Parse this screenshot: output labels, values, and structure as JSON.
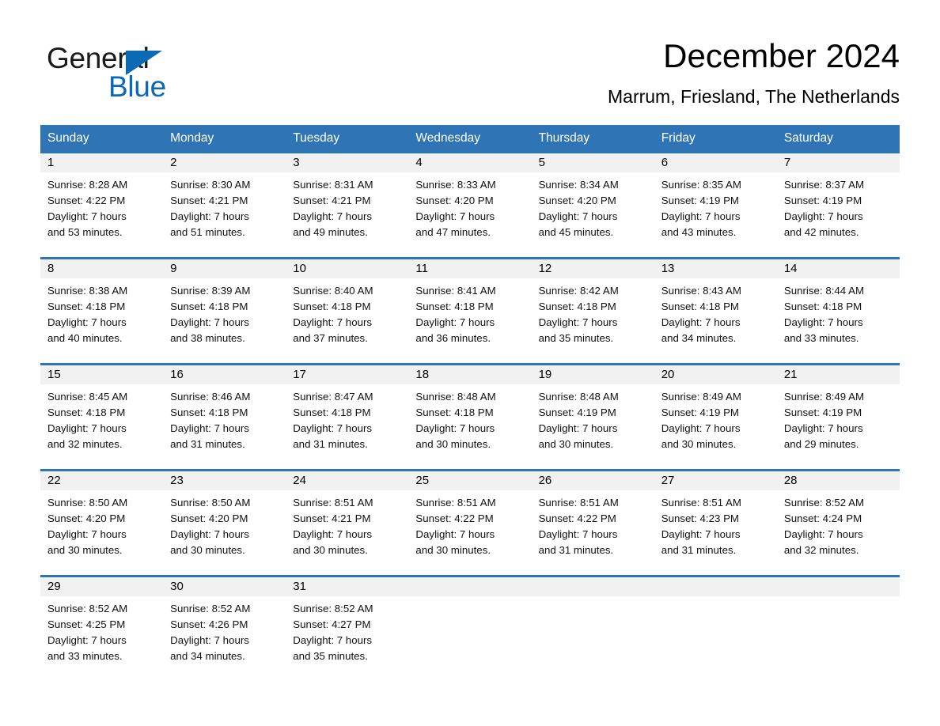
{
  "brand": {
    "name_part1": "General",
    "name_part2": "Blue",
    "accent_color": "#0a6ab5"
  },
  "header": {
    "month_title": "December 2024",
    "location": "Marrum, Friesland, The Netherlands"
  },
  "theme": {
    "header_blue": "#2f75b5",
    "daynum_band": "#f1f1f1",
    "text": "#000000"
  },
  "calendar": {
    "weekday_headers": [
      "Sunday",
      "Monday",
      "Tuesday",
      "Wednesday",
      "Thursday",
      "Friday",
      "Saturday"
    ],
    "weeks": [
      [
        {
          "day": "1",
          "sunrise": "Sunrise: 8:28 AM",
          "sunset": "Sunset: 4:22 PM",
          "daylight_line1": "Daylight: 7 hours",
          "daylight_line2": "and 53 minutes."
        },
        {
          "day": "2",
          "sunrise": "Sunrise: 8:30 AM",
          "sunset": "Sunset: 4:21 PM",
          "daylight_line1": "Daylight: 7 hours",
          "daylight_line2": "and 51 minutes."
        },
        {
          "day": "3",
          "sunrise": "Sunrise: 8:31 AM",
          "sunset": "Sunset: 4:21 PM",
          "daylight_line1": "Daylight: 7 hours",
          "daylight_line2": "and 49 minutes."
        },
        {
          "day": "4",
          "sunrise": "Sunrise: 8:33 AM",
          "sunset": "Sunset: 4:20 PM",
          "daylight_line1": "Daylight: 7 hours",
          "daylight_line2": "and 47 minutes."
        },
        {
          "day": "5",
          "sunrise": "Sunrise: 8:34 AM",
          "sunset": "Sunset: 4:20 PM",
          "daylight_line1": "Daylight: 7 hours",
          "daylight_line2": "and 45 minutes."
        },
        {
          "day": "6",
          "sunrise": "Sunrise: 8:35 AM",
          "sunset": "Sunset: 4:19 PM",
          "daylight_line1": "Daylight: 7 hours",
          "daylight_line2": "and 43 minutes."
        },
        {
          "day": "7",
          "sunrise": "Sunrise: 8:37 AM",
          "sunset": "Sunset: 4:19 PM",
          "daylight_line1": "Daylight: 7 hours",
          "daylight_line2": "and 42 minutes."
        }
      ],
      [
        {
          "day": "8",
          "sunrise": "Sunrise: 8:38 AM",
          "sunset": "Sunset: 4:18 PM",
          "daylight_line1": "Daylight: 7 hours",
          "daylight_line2": "and 40 minutes."
        },
        {
          "day": "9",
          "sunrise": "Sunrise: 8:39 AM",
          "sunset": "Sunset: 4:18 PM",
          "daylight_line1": "Daylight: 7 hours",
          "daylight_line2": "and 38 minutes."
        },
        {
          "day": "10",
          "sunrise": "Sunrise: 8:40 AM",
          "sunset": "Sunset: 4:18 PM",
          "daylight_line1": "Daylight: 7 hours",
          "daylight_line2": "and 37 minutes."
        },
        {
          "day": "11",
          "sunrise": "Sunrise: 8:41 AM",
          "sunset": "Sunset: 4:18 PM",
          "daylight_line1": "Daylight: 7 hours",
          "daylight_line2": "and 36 minutes."
        },
        {
          "day": "12",
          "sunrise": "Sunrise: 8:42 AM",
          "sunset": "Sunset: 4:18 PM",
          "daylight_line1": "Daylight: 7 hours",
          "daylight_line2": "and 35 minutes."
        },
        {
          "day": "13",
          "sunrise": "Sunrise: 8:43 AM",
          "sunset": "Sunset: 4:18 PM",
          "daylight_line1": "Daylight: 7 hours",
          "daylight_line2": "and 34 minutes."
        },
        {
          "day": "14",
          "sunrise": "Sunrise: 8:44 AM",
          "sunset": "Sunset: 4:18 PM",
          "daylight_line1": "Daylight: 7 hours",
          "daylight_line2": "and 33 minutes."
        }
      ],
      [
        {
          "day": "15",
          "sunrise": "Sunrise: 8:45 AM",
          "sunset": "Sunset: 4:18 PM",
          "daylight_line1": "Daylight: 7 hours",
          "daylight_line2": "and 32 minutes."
        },
        {
          "day": "16",
          "sunrise": "Sunrise: 8:46 AM",
          "sunset": "Sunset: 4:18 PM",
          "daylight_line1": "Daylight: 7 hours",
          "daylight_line2": "and 31 minutes."
        },
        {
          "day": "17",
          "sunrise": "Sunrise: 8:47 AM",
          "sunset": "Sunset: 4:18 PM",
          "daylight_line1": "Daylight: 7 hours",
          "daylight_line2": "and 31 minutes."
        },
        {
          "day": "18",
          "sunrise": "Sunrise: 8:48 AM",
          "sunset": "Sunset: 4:18 PM",
          "daylight_line1": "Daylight: 7 hours",
          "daylight_line2": "and 30 minutes."
        },
        {
          "day": "19",
          "sunrise": "Sunrise: 8:48 AM",
          "sunset": "Sunset: 4:19 PM",
          "daylight_line1": "Daylight: 7 hours",
          "daylight_line2": "and 30 minutes."
        },
        {
          "day": "20",
          "sunrise": "Sunrise: 8:49 AM",
          "sunset": "Sunset: 4:19 PM",
          "daylight_line1": "Daylight: 7 hours",
          "daylight_line2": "and 30 minutes."
        },
        {
          "day": "21",
          "sunrise": "Sunrise: 8:49 AM",
          "sunset": "Sunset: 4:19 PM",
          "daylight_line1": "Daylight: 7 hours",
          "daylight_line2": "and 29 minutes."
        }
      ],
      [
        {
          "day": "22",
          "sunrise": "Sunrise: 8:50 AM",
          "sunset": "Sunset: 4:20 PM",
          "daylight_line1": "Daylight: 7 hours",
          "daylight_line2": "and 30 minutes."
        },
        {
          "day": "23",
          "sunrise": "Sunrise: 8:50 AM",
          "sunset": "Sunset: 4:20 PM",
          "daylight_line1": "Daylight: 7 hours",
          "daylight_line2": "and 30 minutes."
        },
        {
          "day": "24",
          "sunrise": "Sunrise: 8:51 AM",
          "sunset": "Sunset: 4:21 PM",
          "daylight_line1": "Daylight: 7 hours",
          "daylight_line2": "and 30 minutes."
        },
        {
          "day": "25",
          "sunrise": "Sunrise: 8:51 AM",
          "sunset": "Sunset: 4:22 PM",
          "daylight_line1": "Daylight: 7 hours",
          "daylight_line2": "and 30 minutes."
        },
        {
          "day": "26",
          "sunrise": "Sunrise: 8:51 AM",
          "sunset": "Sunset: 4:22 PM",
          "daylight_line1": "Daylight: 7 hours",
          "daylight_line2": "and 31 minutes."
        },
        {
          "day": "27",
          "sunrise": "Sunrise: 8:51 AM",
          "sunset": "Sunset: 4:23 PM",
          "daylight_line1": "Daylight: 7 hours",
          "daylight_line2": "and 31 minutes."
        },
        {
          "day": "28",
          "sunrise": "Sunrise: 8:52 AM",
          "sunset": "Sunset: 4:24 PM",
          "daylight_line1": "Daylight: 7 hours",
          "daylight_line2": "and 32 minutes."
        }
      ],
      [
        {
          "day": "29",
          "sunrise": "Sunrise: 8:52 AM",
          "sunset": "Sunset: 4:25 PM",
          "daylight_line1": "Daylight: 7 hours",
          "daylight_line2": "and 33 minutes."
        },
        {
          "day": "30",
          "sunrise": "Sunrise: 8:52 AM",
          "sunset": "Sunset: 4:26 PM",
          "daylight_line1": "Daylight: 7 hours",
          "daylight_line2": "and 34 minutes."
        },
        {
          "day": "31",
          "sunrise": "Sunrise: 8:52 AM",
          "sunset": "Sunset: 4:27 PM",
          "daylight_line1": "Daylight: 7 hours",
          "daylight_line2": "and 35 minutes."
        },
        {
          "day": "",
          "sunrise": "",
          "sunset": "",
          "daylight_line1": "",
          "daylight_line2": ""
        },
        {
          "day": "",
          "sunrise": "",
          "sunset": "",
          "daylight_line1": "",
          "daylight_line2": ""
        },
        {
          "day": "",
          "sunrise": "",
          "sunset": "",
          "daylight_line1": "",
          "daylight_line2": ""
        },
        {
          "day": "",
          "sunrise": "",
          "sunset": "",
          "daylight_line1": "",
          "daylight_line2": ""
        }
      ]
    ]
  }
}
